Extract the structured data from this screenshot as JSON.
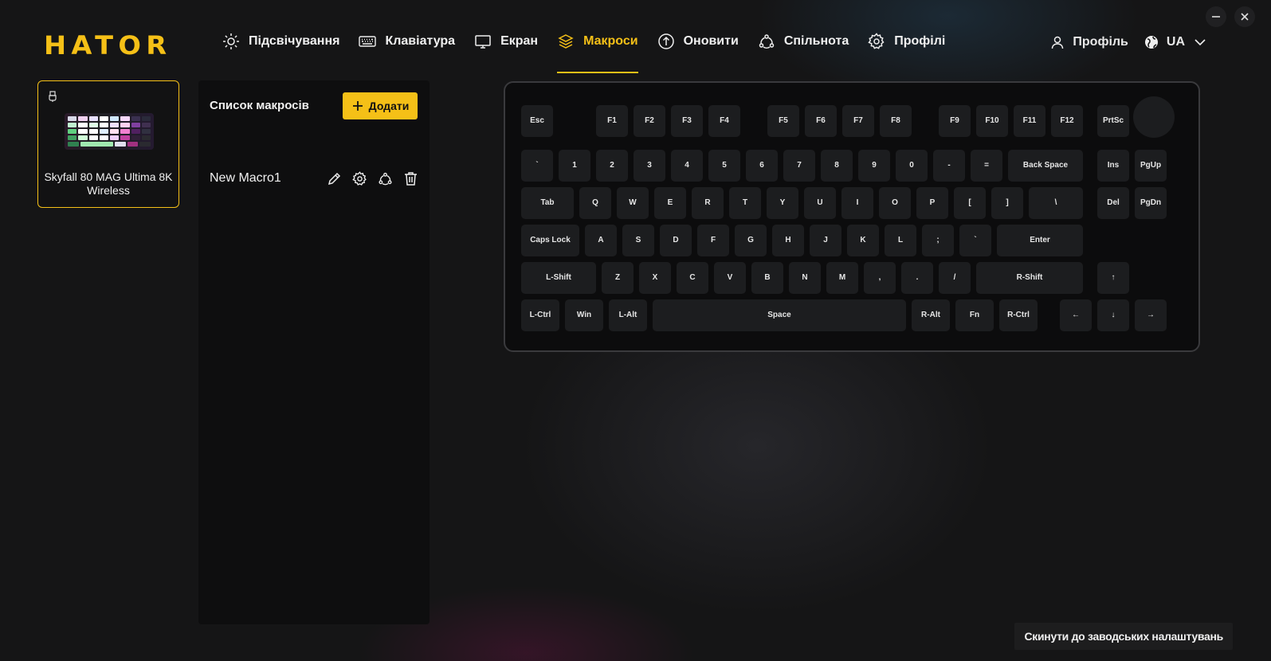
{
  "brand": {
    "logo": "HATOR",
    "accent": "#f5c017"
  },
  "nav": [
    {
      "id": "lighting",
      "label": "Підсвічування",
      "icon": "sun-icon",
      "active": false
    },
    {
      "id": "keyboard",
      "label": "Клавіатура",
      "icon": "keyboard-icon",
      "active": false
    },
    {
      "id": "screen",
      "label": "Екран",
      "icon": "monitor-icon",
      "active": false
    },
    {
      "id": "macros",
      "label": "Макроси",
      "icon": "layers-icon",
      "active": true
    },
    {
      "id": "update",
      "label": "Оновити",
      "icon": "upload-circle-icon",
      "active": false
    },
    {
      "id": "community",
      "label": "Спільнота",
      "icon": "community-icon",
      "active": false
    },
    {
      "id": "profiles",
      "label": "Профілі",
      "icon": "gear-icon",
      "active": false
    }
  ],
  "topright": {
    "profile_label": "Профіль",
    "language": "UA"
  },
  "device": {
    "name": "Skyfall 80 MAG Ultima 8K Wireless"
  },
  "macros": {
    "title": "Список макросів",
    "add_label": "Додати",
    "items": [
      {
        "name": "New Macro1"
      }
    ]
  },
  "keyboard": {
    "rows": [
      [
        "Esc",
        "F1",
        "F2",
        "F3",
        "F4",
        "F5",
        "F6",
        "F7",
        "F8",
        "F9",
        "F10",
        "F11",
        "F12",
        "PrtSc"
      ],
      [
        "`",
        "1",
        "2",
        "3",
        "4",
        "5",
        "6",
        "7",
        "8",
        "9",
        "0",
        "-",
        "=",
        "Back Space",
        "Ins",
        "PgUp"
      ],
      [
        "Tab",
        "Q",
        "W",
        "E",
        "R",
        "T",
        "Y",
        "U",
        "I",
        "O",
        "P",
        "[",
        "]",
        "\\",
        "Del",
        "PgDn"
      ],
      [
        "Caps Lock",
        "A",
        "S",
        "D",
        "F",
        "G",
        "H",
        "J",
        "K",
        "L",
        ";",
        "`",
        "Enter"
      ],
      [
        "L-Shift",
        "Z",
        "X",
        "C",
        "V",
        "B",
        "N",
        "M",
        ",",
        ".",
        "/",
        "R-Shift",
        "↑"
      ],
      [
        "L-Ctrl",
        "Win",
        "L-Alt",
        "Space",
        "R-Alt",
        "Fn",
        "R-Ctrl",
        "←",
        "↓",
        "→"
      ]
    ]
  },
  "reset_label": "Скинути до заводських налаштувань"
}
